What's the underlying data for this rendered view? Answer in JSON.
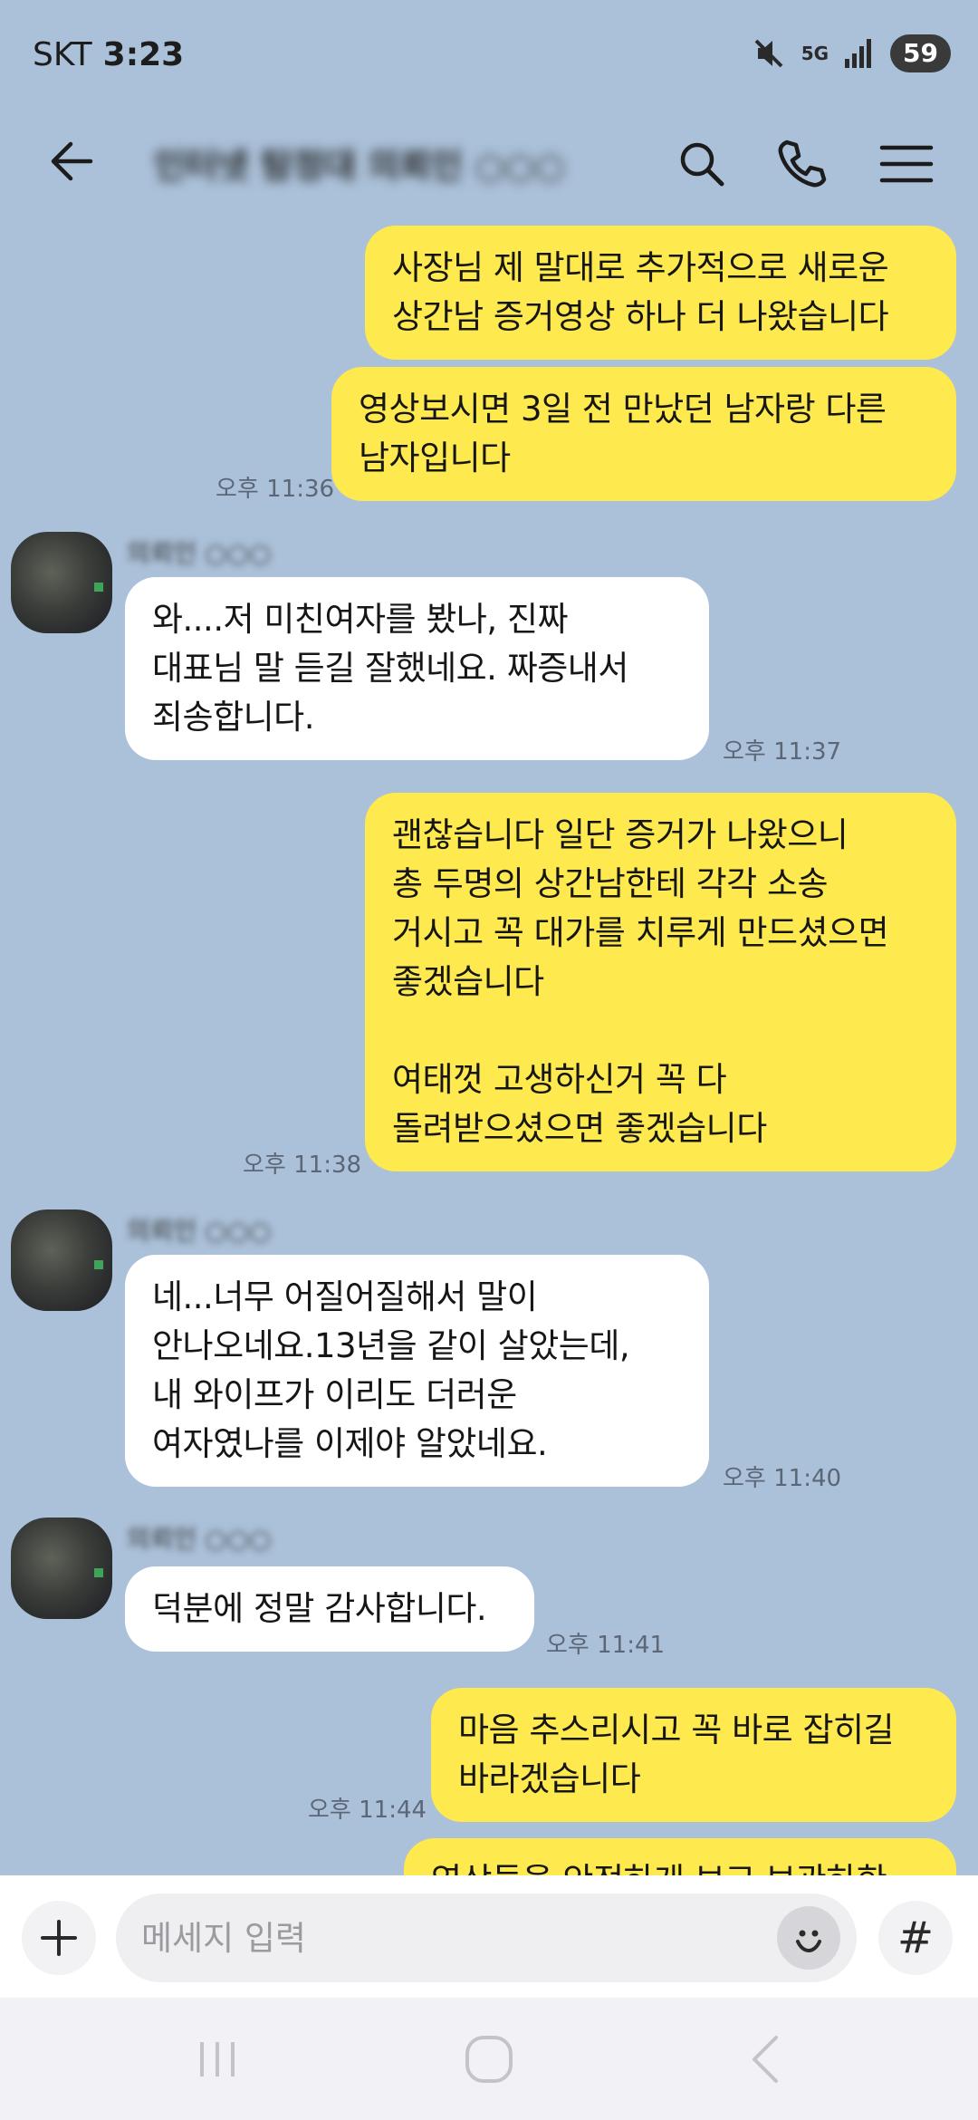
{
  "status": {
    "carrier": "SKT",
    "time": "3:23",
    "network": "5G",
    "battery": "59"
  },
  "header": {
    "title": "인터넷 탐정대 의뢰인 ○○○"
  },
  "messages": [
    {
      "from": "me",
      "text": "사장님 제 말대로 추가적으로 새로운\n상간남 증거영상 하나 더 나왔습니다"
    },
    {
      "from": "me",
      "text": "영상보시면 3일 전 만났던 남자랑 다른\n남자입니다",
      "time": "오후 11:36"
    },
    {
      "from": "other",
      "sender": "의뢰인 ○○○",
      "text": "와....저 미친여자를 봤나, 진짜\n대표님 말 듣길 잘했네요. 짜증내서\n죄송합니다.",
      "time": "오후 11:37"
    },
    {
      "from": "me",
      "text": "괜찮습니다 일단 증거가 나왔으니\n총 두명의 상간남한테 각각 소송\n거시고 꼭 대가를 치루게 만드셨으면\n좋겠습니다\n\n여태껏 고생하신거 꼭 다\n돌려받으셨으면 좋겠습니다",
      "time": "오후 11:38"
    },
    {
      "from": "other",
      "sender": "의뢰인 ○○○",
      "text": "네...너무 어질어질해서 말이\n안나오네요.13년을 같이 살았는데,\n내 와이프가 이리도 더러운\n여자였나를 이제야 알았네요.",
      "time": "오후 11:40"
    },
    {
      "from": "other",
      "sender": "의뢰인 ○○○",
      "text": "덕분에 정말 감사합니다.",
      "time": "오후 11:41"
    },
    {
      "from": "me",
      "text": "마음 추스리시고 꼭 바로 잡히길\n바라겠습니다",
      "time": "오후 11:44"
    },
    {
      "from": "me",
      "text": "영상들을 안전하게 보고 보관하한"
    }
  ],
  "input": {
    "placeholder": "메세지 입력"
  },
  "icons": {
    "back": "arrow-left-icon",
    "search": "search-icon",
    "call": "phone-icon",
    "menu": "hamburger-menu-icon",
    "plus": "plus-icon",
    "emoji": "smiley-icon",
    "hash": "#"
  },
  "colors": {
    "background": "#abc1d9",
    "my_bubble": "#fee94e",
    "other_bubble": "#ffffff"
  }
}
